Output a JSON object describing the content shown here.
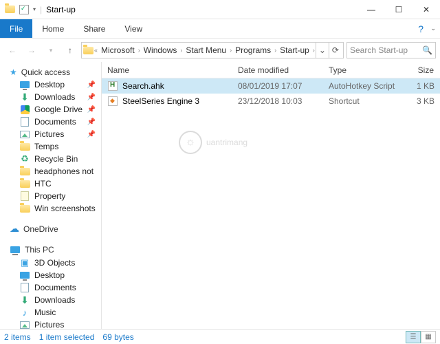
{
  "window": {
    "title": "Start-up"
  },
  "ribbon": {
    "file": "File",
    "tabs": [
      "Home",
      "Share",
      "View"
    ]
  },
  "breadcrumbs": [
    "Microsoft",
    "Windows",
    "Start Menu",
    "Programs",
    "Start-up"
  ],
  "search": {
    "placeholder": "Search Start-up"
  },
  "columns": {
    "name": "Name",
    "date": "Date modified",
    "type": "Type",
    "size": "Size"
  },
  "files": [
    {
      "name": "Search.ahk",
      "date": "08/01/2019 17:07",
      "type": "AutoHotkey Script",
      "size": "1 KB",
      "icon": "ahk",
      "selected": true
    },
    {
      "name": "SteelSeries Engine 3",
      "date": "23/12/2018 10:03",
      "type": "Shortcut",
      "size": "3 KB",
      "icon": "ss",
      "selected": false
    }
  ],
  "sidebar": {
    "quick_access": "Quick access",
    "qa_items": [
      {
        "label": "Desktop",
        "icon": "desktop",
        "pinned": true
      },
      {
        "label": "Downloads",
        "icon": "downloads",
        "pinned": true
      },
      {
        "label": "Google Drive",
        "icon": "gdrive",
        "pinned": true
      },
      {
        "label": "Documents",
        "icon": "doc",
        "pinned": true
      },
      {
        "label": "Pictures",
        "icon": "pic",
        "pinned": true
      },
      {
        "label": "Temps",
        "icon": "folder",
        "pinned": false
      },
      {
        "label": "Recycle Bin",
        "icon": "recycle",
        "pinned": false
      },
      {
        "label": "headphones not",
        "icon": "folder",
        "pinned": false
      },
      {
        "label": "HTC",
        "icon": "folder",
        "pinned": false
      },
      {
        "label": "Property",
        "icon": "property",
        "pinned": false
      },
      {
        "label": "Win screenshots",
        "icon": "folder",
        "pinned": false
      }
    ],
    "onedrive": "OneDrive",
    "this_pc": "This PC",
    "pc_items": [
      {
        "label": "3D Objects",
        "icon": "3d"
      },
      {
        "label": "Desktop",
        "icon": "desktop"
      },
      {
        "label": "Documents",
        "icon": "doc"
      },
      {
        "label": "Downloads",
        "icon": "downloads"
      },
      {
        "label": "Music",
        "icon": "music"
      },
      {
        "label": "Pictures",
        "icon": "pic"
      }
    ]
  },
  "status": {
    "items": "2 items",
    "selected": "1 item selected",
    "size": "69 bytes"
  },
  "watermark": "uantrimang"
}
